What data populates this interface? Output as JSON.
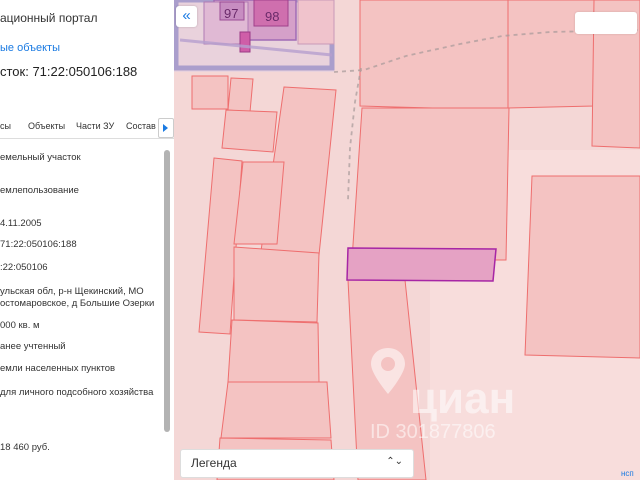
{
  "panel": {
    "title": "ационный портал",
    "link": "ые объекты",
    "plot_label": "сток: 71:22:050106:188",
    "tabs": [
      "сы",
      "Объекты",
      "Части ЗУ",
      "Состав"
    ],
    "info": [
      "емельный участок",
      "емлепользование",
      "4.11.2005",
      "71:22:050106:188",
      ":22:050106",
      "ульская обл, р-н Щекинский, МО",
      "остомаровское, д Большие Озерки",
      "000 кв. м",
      "анее учтенный",
      "емли населенных пунктов",
      "для личного подсобного хозяйства",
      "18 460 руб."
    ]
  },
  "map": {
    "labels": [
      "97",
      "98"
    ],
    "legend_label": "Легенда",
    "watermark_brand": "циан",
    "watermark_id": "ID 301877806",
    "corner_link": "нсп"
  },
  "colors": {
    "accent": "#1a7ae2",
    "parcel_fill": "#f4c3c2",
    "parcel_stroke": "#ee6e6e",
    "selected_fill": "#e5a2c4",
    "selected_stroke": "#a726a5"
  }
}
